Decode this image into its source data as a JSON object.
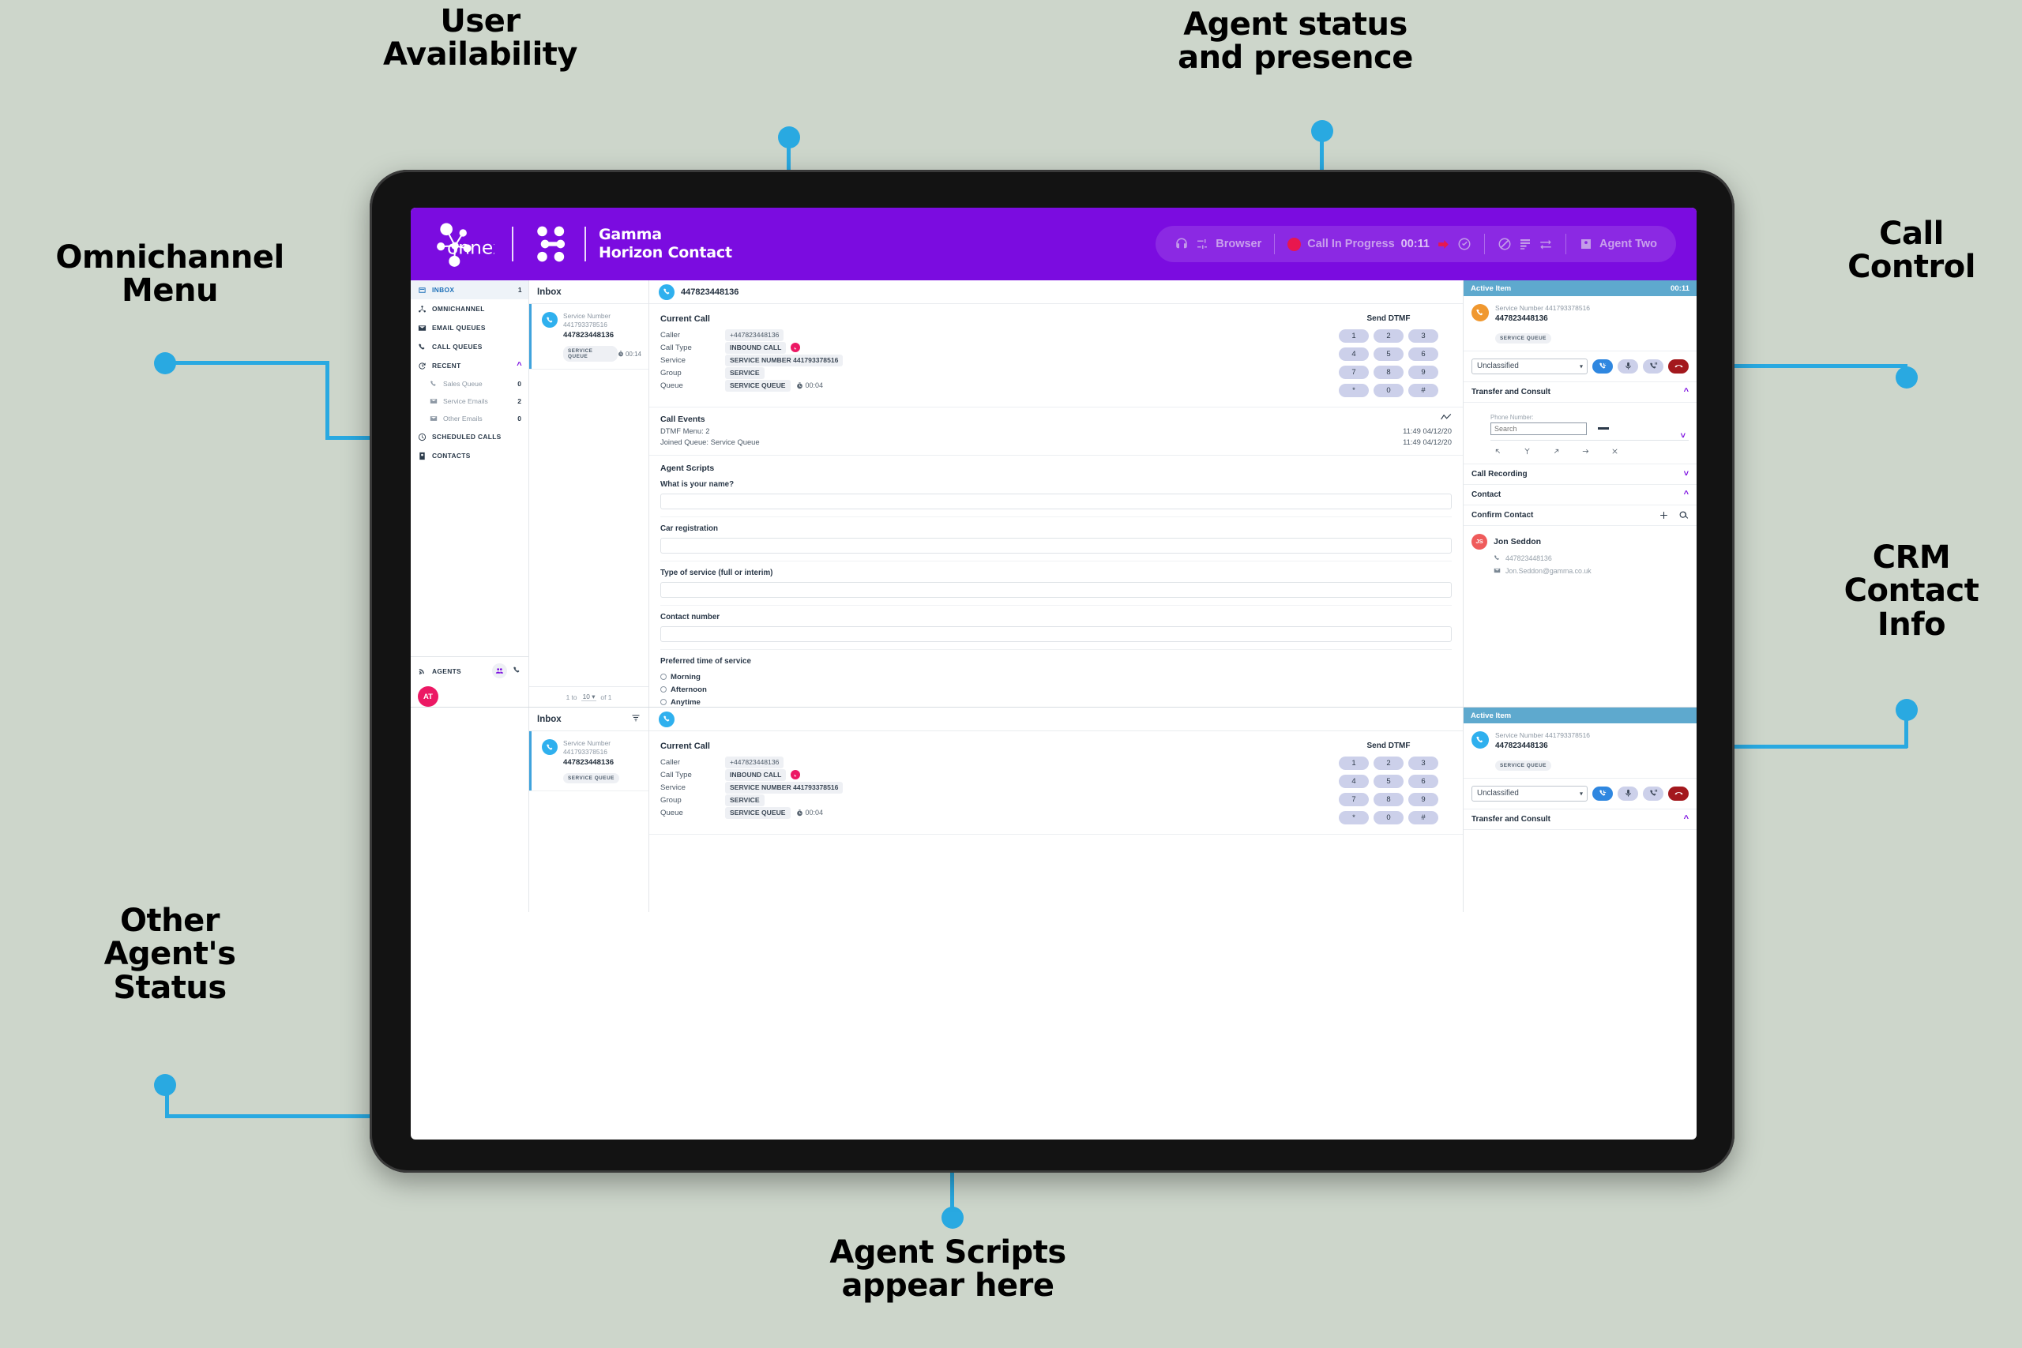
{
  "callouts": [
    {
      "id": "user-availability",
      "text": "User\nAvailability"
    },
    {
      "id": "agent-status",
      "text": "Agent status\nand presence"
    },
    {
      "id": "omnichannel-menu",
      "text": "Omnichannel\nMenu"
    },
    {
      "id": "call-control",
      "text": "Call\nControl"
    },
    {
      "id": "crm-contact-info",
      "text": "CRM\nContact\nInfo"
    },
    {
      "id": "other-agents-status",
      "text": "Other\nAgent's\nStatus"
    },
    {
      "id": "agent-scripts",
      "text": "Agent Scripts\nappear here"
    }
  ],
  "colors": {
    "brand_purple": "#7b0ce0",
    "accent_blue": "#29a9e1",
    "active_item_header": "#5ea9ce",
    "status_red": "#e8174e",
    "hangup_red": "#a3181d",
    "page_background": "#cdd6cb"
  },
  "appbar": {
    "brand_name": "connexus",
    "product_line1": "Gamma",
    "product_line2": "Horizon Contact",
    "status": {
      "headset_label": "Browser",
      "presence_label": "Call In Progress",
      "presence_timer": "00:11",
      "agent_name": "Agent Two"
    }
  },
  "sidebar": {
    "items": [
      {
        "label": "INBOX",
        "icon": "inbox-icon",
        "count": "1",
        "active": true
      },
      {
        "label": "OMNICHANNEL",
        "icon": "omnichannel-icon",
        "count": "",
        "active": false
      },
      {
        "label": "EMAIL QUEUES",
        "icon": "email-icon",
        "count": "",
        "active": false
      },
      {
        "label": "CALL QUEUES",
        "icon": "phone-icon",
        "count": "",
        "active": false
      },
      {
        "label": "RECENT",
        "icon": "history-icon",
        "count": "",
        "active": false,
        "chevron": "⌃"
      }
    ],
    "recent_children": [
      {
        "label": "Sales Queue",
        "icon": "phone-icon",
        "count": "0"
      },
      {
        "label": "Service Emails",
        "icon": "email-icon",
        "count": "2"
      },
      {
        "label": "Other Emails",
        "icon": "email-icon",
        "count": "0"
      }
    ],
    "items_after": [
      {
        "label": "SCHEDULED CALLS",
        "icon": "clock-icon",
        "count": ""
      },
      {
        "label": "CONTACTS",
        "icon": "contacts-icon",
        "count": ""
      }
    ],
    "agents": {
      "label": "AGENTS",
      "avatar_initials": "AT"
    }
  },
  "inbox": {
    "title": "Inbox",
    "pagination": {
      "prefix": "1 to",
      "page_size": "10",
      "suffix": "of 1"
    },
    "item": {
      "service_label": "Service Number",
      "service_number": "441793378516",
      "caller_number": "447823448136",
      "queue_badge": "SERVICE QUEUE",
      "timer": "00:14"
    }
  },
  "detail": {
    "header_number": "447823448136",
    "current_call": {
      "title": "Current Call",
      "rows": [
        {
          "key": "Caller",
          "value": "+447823448136",
          "style": "plain"
        },
        {
          "key": "Call Type",
          "value": "INBOUND CALL",
          "style": "bold",
          "icon": "inbound-arrow-icon"
        },
        {
          "key": "Service",
          "value": "SERVICE NUMBER 441793378516",
          "style": "bold"
        },
        {
          "key": "Group",
          "value": "SERVICE",
          "style": "bold"
        },
        {
          "key": "Queue",
          "value": "SERVICE QUEUE",
          "style": "bold",
          "timer": "00:04"
        }
      ]
    },
    "dtmf": {
      "title": "Send DTMF",
      "keys": [
        "1",
        "2",
        "3",
        "4",
        "5",
        "6",
        "7",
        "8",
        "9",
        "*",
        "0",
        "#"
      ]
    },
    "call_events": {
      "title": "Call Events",
      "rows": [
        {
          "text": "DTMF Menu: 2",
          "time": "11:49 04/12/20"
        },
        {
          "text": "Joined Queue: Service Queue",
          "time": "11:49 04/12/20"
        }
      ]
    },
    "agent_scripts": {
      "title": "Agent Scripts",
      "fields": [
        {
          "label": "What is your name?",
          "value": "",
          "type": "text"
        },
        {
          "label": "Car registration",
          "value": "",
          "type": "text"
        },
        {
          "label": "Type of service (full or interim)",
          "value": "",
          "type": "text"
        },
        {
          "label": "Contact number",
          "value": "",
          "type": "text"
        }
      ],
      "radio_group": {
        "label": "Preferred time of service",
        "options": [
          "Morning",
          "Afternoon",
          "Anytime"
        ],
        "selected": ""
      }
    }
  },
  "rightrail": {
    "active_item": {
      "title": "Active Item",
      "timer": "00:11",
      "service_label": "Service Number 441793378516",
      "caller_number": "447823448136",
      "queue_badge": "SERVICE QUEUE"
    },
    "controls": {
      "classification_value": "Unclassified",
      "buttons": [
        {
          "name": "answer-call-button",
          "icon": "phone-incoming-icon"
        },
        {
          "name": "mute-button",
          "icon": "microphone-icon"
        },
        {
          "name": "hold-button",
          "icon": "phone-pause-icon"
        },
        {
          "name": "hangup-button",
          "icon": "phone-hangup-icon"
        }
      ]
    },
    "transfer": {
      "title": "Transfer and Consult",
      "phone_label": "Phone Number:",
      "search_placeholder": "Search",
      "search_value": ""
    },
    "call_recording": {
      "title": "Call Recording"
    },
    "contact_section": {
      "title": "Contact"
    },
    "confirm_contact": {
      "title": "Confirm Contact"
    },
    "contact": {
      "initials": "JS",
      "name": "Jon Seddon",
      "phone": "447823448136",
      "email": "Jon.Seddon@gamma.co.uk"
    }
  },
  "window2": {
    "inbox_title": "Inbox",
    "item": {
      "service_label": "Service Number",
      "service_number": "441793378516",
      "caller_number": "447823448136",
      "queue_badge": "SERVICE QUEUE"
    },
    "current_call": {
      "title": "Current Call",
      "rows": [
        {
          "key": "Caller",
          "value": "+447823448136",
          "style": "plain"
        },
        {
          "key": "Call Type",
          "value": "INBOUND CALL",
          "style": "bold",
          "icon": "inbound-arrow-icon"
        },
        {
          "key": "Service",
          "value": "SERVICE NUMBER 441793378516",
          "style": "bold"
        },
        {
          "key": "Group",
          "value": "SERVICE",
          "style": "bold"
        },
        {
          "key": "Queue",
          "value": "SERVICE QUEUE",
          "style": "bold",
          "timer": "00:04"
        }
      ]
    },
    "dtmf": {
      "title": "Send DTMF",
      "keys": [
        "1",
        "2",
        "3",
        "4",
        "5",
        "6",
        "7",
        "8",
        "9",
        "*",
        "0",
        "#"
      ]
    },
    "active_item": {
      "title": "Active Item",
      "service_label": "Service Number 441793378516",
      "caller_number": "447823448136",
      "queue_badge": "SERVICE QUEUE"
    },
    "controls": {
      "classification_value": "Unclassified"
    },
    "transfer": {
      "title": "Transfer and Consult"
    }
  }
}
